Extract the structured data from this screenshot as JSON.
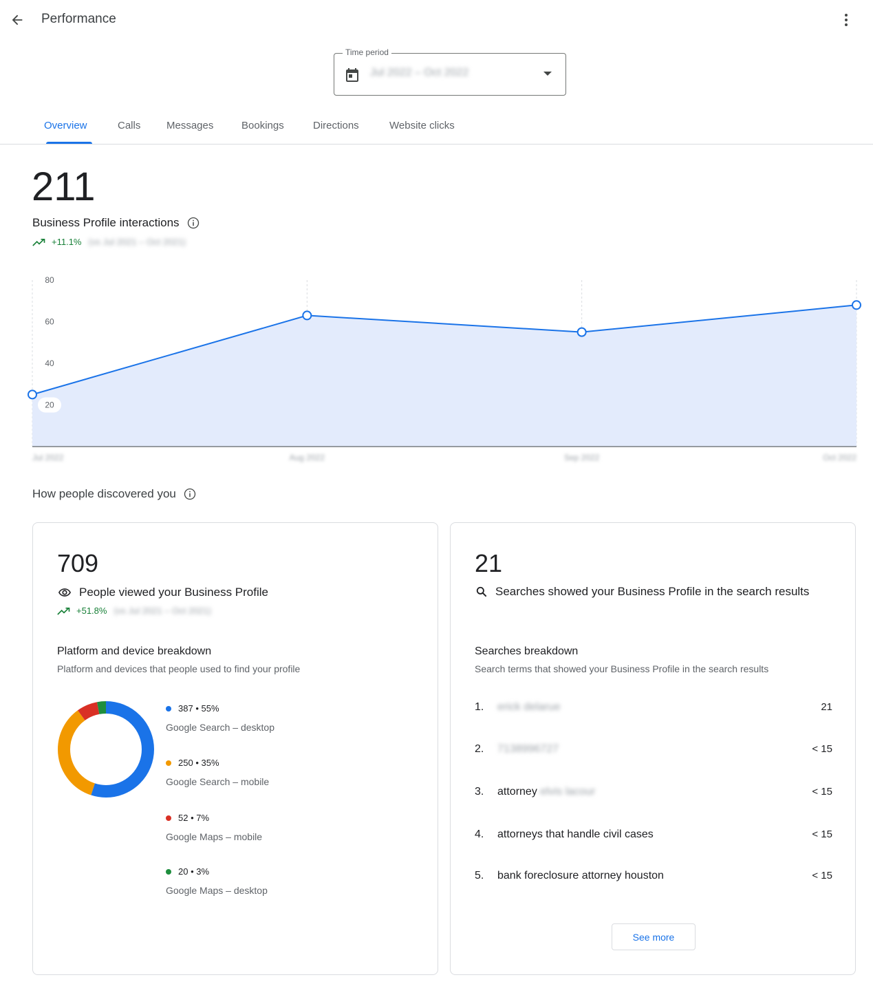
{
  "header": {
    "title": "Performance",
    "back_icon": "arrow-back-icon",
    "more_icon": "more-vert-icon"
  },
  "time_period": {
    "label": "Time period",
    "value": "Jul 2022 – Oct 2022",
    "icon": "calendar-icon"
  },
  "tabs": [
    {
      "label": "Overview",
      "active": true
    },
    {
      "label": "Calls",
      "active": false
    },
    {
      "label": "Messages",
      "active": false
    },
    {
      "label": "Bookings",
      "active": false
    },
    {
      "label": "Directions",
      "active": false
    },
    {
      "label": "Website clicks",
      "active": false
    }
  ],
  "interactions": {
    "value": "211",
    "label": "Business Profile interactions",
    "change": "+11.1%",
    "comparison": "(vs Jul 2021 – Oct 2021)"
  },
  "chart_data": {
    "type": "area",
    "x": [
      "Jul 2022",
      "Aug 2022",
      "Sep 2022",
      "Oct 2022"
    ],
    "values": [
      25,
      63,
      55,
      68
    ],
    "yticks": [
      20,
      40,
      60,
      80
    ],
    "ylim": [
      0,
      80
    ],
    "grid": "vertical-dashed",
    "colors": {
      "line": "#1a73e8",
      "fill": "#e3ebfc"
    }
  },
  "discovery": {
    "title": "How people discovered you"
  },
  "views_card": {
    "value": "709",
    "label": "People viewed your Business Profile",
    "change": "+51.8%",
    "comparison": "(vs Jul 2021 – Oct 2021)",
    "breakdown_title": "Platform and device breakdown",
    "breakdown_desc": "Platform and devices that people used to find your profile",
    "segments": [
      {
        "count": "387",
        "pct": "55%",
        "percent": 55,
        "label": "Google Search – desktop",
        "color": "#1a73e8"
      },
      {
        "count": "250",
        "pct": "35%",
        "percent": 35,
        "label": "Google Search – mobile",
        "color": "#f29900"
      },
      {
        "count": "52",
        "pct": "7%",
        "percent": 7,
        "label": "Google Maps – mobile",
        "color": "#d93025"
      },
      {
        "count": "20",
        "pct": "3%",
        "percent": 3,
        "label": "Google Maps – desktop",
        "color": "#1e8e3e"
      }
    ]
  },
  "search_card": {
    "value": "21",
    "label": "Searches showed your Business Profile in the search results",
    "breakdown_title": "Searches breakdown",
    "breakdown_desc": "Search terms that showed your Business Profile in the search results",
    "terms": [
      {
        "index": "1.",
        "prefix": "",
        "hidden": "erick delarue",
        "value": "21"
      },
      {
        "index": "2.",
        "prefix": "",
        "hidden": "7138996727",
        "value": "< 15"
      },
      {
        "index": "3.",
        "prefix": "attorney ",
        "hidden": "elvis lacour",
        "value": "< 15"
      },
      {
        "index": "4.",
        "prefix": "attorneys that handle civil cases",
        "hidden": "",
        "value": "< 15"
      },
      {
        "index": "5.",
        "prefix": "bank foreclosure attorney houston",
        "hidden": "",
        "value": "< 15"
      }
    ],
    "see_more": "See more"
  }
}
